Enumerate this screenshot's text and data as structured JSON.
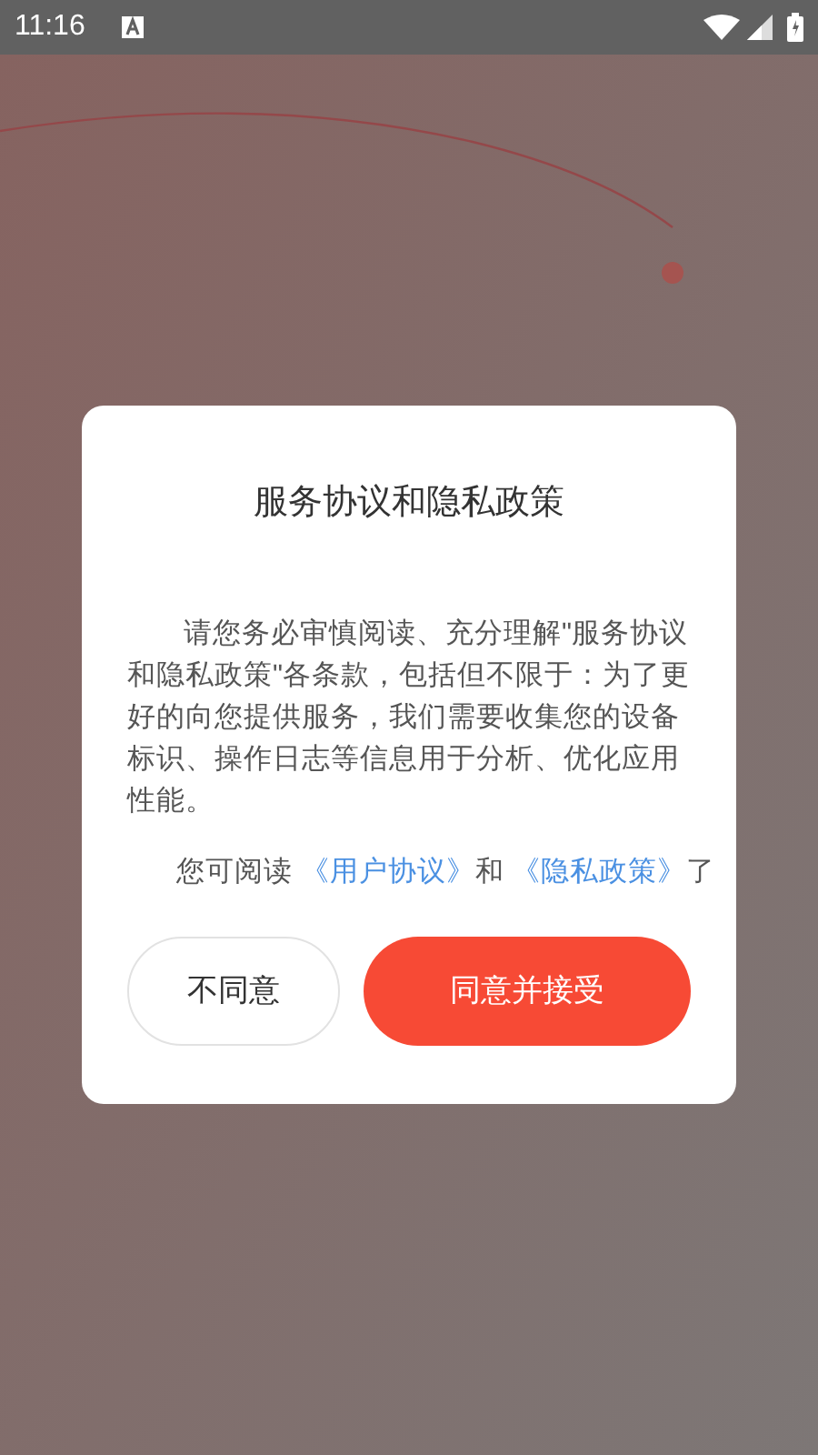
{
  "status_bar": {
    "time": "11:16"
  },
  "dialog": {
    "title": "服务协议和隐私政策",
    "body": "请您务必审慎阅读、充分理解\"服务协议和隐私政策\"各条款，包括但不限于：为了更好的向您提供服务，我们需要收集您的设备标识、操作日志等信息用于分析、优化应用性能。",
    "consent": {
      "before": "您可阅读",
      "link_1": "《用户协议》",
      "middle": "和",
      "link_2": "《隐私政策》",
      "after": "了"
    },
    "buttons": [
      {
        "kind": "secondary",
        "label": "不同意"
      },
      {
        "kind": "primary",
        "label": "同意并接受"
      }
    ]
  }
}
